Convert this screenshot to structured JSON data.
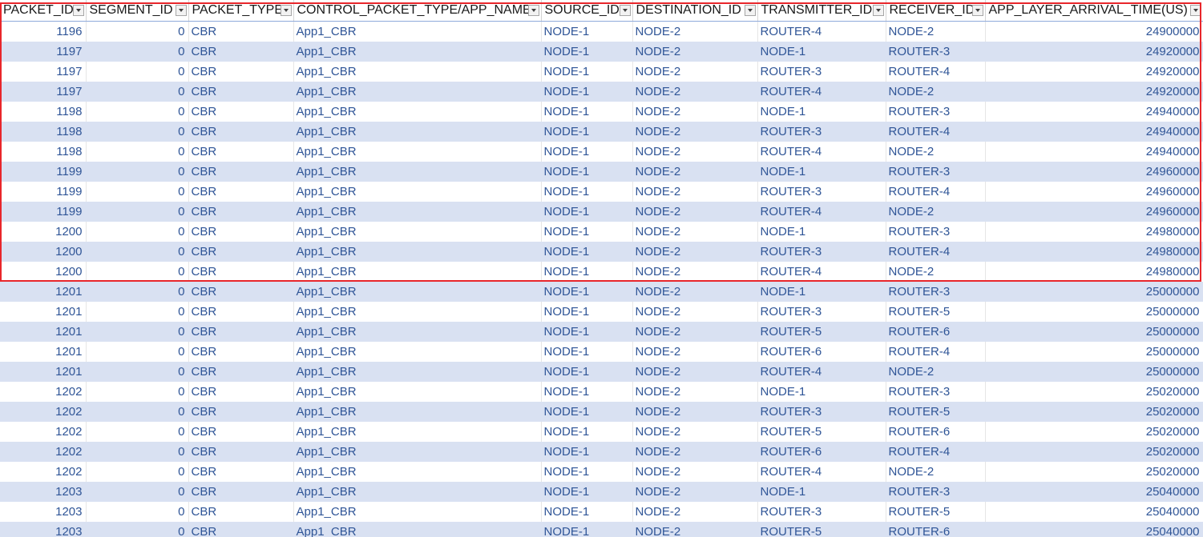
{
  "table": {
    "columns": [
      "PACKET_ID",
      "SEGMENT_ID",
      "PACKET_TYPE",
      "CONTROL_PACKET_TYPE/APP_NAME",
      "SOURCE_ID",
      "DESTINATION_ID",
      "TRANSMITTER_ID",
      "RECEIVER_ID",
      "APP_LAYER_ARRIVAL_TIME(US)"
    ],
    "rows": [
      [
        "1196",
        "0",
        "CBR",
        "App1_CBR",
        "NODE-1",
        "NODE-2",
        "ROUTER-4",
        "NODE-2",
        "24900000"
      ],
      [
        "1197",
        "0",
        "CBR",
        "App1_CBR",
        "NODE-1",
        "NODE-2",
        "NODE-1",
        "ROUTER-3",
        "24920000"
      ],
      [
        "1197",
        "0",
        "CBR",
        "App1_CBR",
        "NODE-1",
        "NODE-2",
        "ROUTER-3",
        "ROUTER-4",
        "24920000"
      ],
      [
        "1197",
        "0",
        "CBR",
        "App1_CBR",
        "NODE-1",
        "NODE-2",
        "ROUTER-4",
        "NODE-2",
        "24920000"
      ],
      [
        "1198",
        "0",
        "CBR",
        "App1_CBR",
        "NODE-1",
        "NODE-2",
        "NODE-1",
        "ROUTER-3",
        "24940000"
      ],
      [
        "1198",
        "0",
        "CBR",
        "App1_CBR",
        "NODE-1",
        "NODE-2",
        "ROUTER-3",
        "ROUTER-4",
        "24940000"
      ],
      [
        "1198",
        "0",
        "CBR",
        "App1_CBR",
        "NODE-1",
        "NODE-2",
        "ROUTER-4",
        "NODE-2",
        "24940000"
      ],
      [
        "1199",
        "0",
        "CBR",
        "App1_CBR",
        "NODE-1",
        "NODE-2",
        "NODE-1",
        "ROUTER-3",
        "24960000"
      ],
      [
        "1199",
        "0",
        "CBR",
        "App1_CBR",
        "NODE-1",
        "NODE-2",
        "ROUTER-3",
        "ROUTER-4",
        "24960000"
      ],
      [
        "1199",
        "0",
        "CBR",
        "App1_CBR",
        "NODE-1",
        "NODE-2",
        "ROUTER-4",
        "NODE-2",
        "24960000"
      ],
      [
        "1200",
        "0",
        "CBR",
        "App1_CBR",
        "NODE-1",
        "NODE-2",
        "NODE-1",
        "ROUTER-3",
        "24980000"
      ],
      [
        "1200",
        "0",
        "CBR",
        "App1_CBR",
        "NODE-1",
        "NODE-2",
        "ROUTER-3",
        "ROUTER-4",
        "24980000"
      ],
      [
        "1200",
        "0",
        "CBR",
        "App1_CBR",
        "NODE-1",
        "NODE-2",
        "ROUTER-4",
        "NODE-2",
        "24980000"
      ],
      [
        "1201",
        "0",
        "CBR",
        "App1_CBR",
        "NODE-1",
        "NODE-2",
        "NODE-1",
        "ROUTER-3",
        "25000000"
      ],
      [
        "1201",
        "0",
        "CBR",
        "App1_CBR",
        "NODE-1",
        "NODE-2",
        "ROUTER-3",
        "ROUTER-5",
        "25000000"
      ],
      [
        "1201",
        "0",
        "CBR",
        "App1_CBR",
        "NODE-1",
        "NODE-2",
        "ROUTER-5",
        "ROUTER-6",
        "25000000"
      ],
      [
        "1201",
        "0",
        "CBR",
        "App1_CBR",
        "NODE-1",
        "NODE-2",
        "ROUTER-6",
        "ROUTER-4",
        "25000000"
      ],
      [
        "1201",
        "0",
        "CBR",
        "App1_CBR",
        "NODE-1",
        "NODE-2",
        "ROUTER-4",
        "NODE-2",
        "25000000"
      ],
      [
        "1202",
        "0",
        "CBR",
        "App1_CBR",
        "NODE-1",
        "NODE-2",
        "NODE-1",
        "ROUTER-3",
        "25020000"
      ],
      [
        "1202",
        "0",
        "CBR",
        "App1_CBR",
        "NODE-1",
        "NODE-2",
        "ROUTER-3",
        "ROUTER-5",
        "25020000"
      ],
      [
        "1202",
        "0",
        "CBR",
        "App1_CBR",
        "NODE-1",
        "NODE-2",
        "ROUTER-5",
        "ROUTER-6",
        "25020000"
      ],
      [
        "1202",
        "0",
        "CBR",
        "App1_CBR",
        "NODE-1",
        "NODE-2",
        "ROUTER-6",
        "ROUTER-4",
        "25020000"
      ],
      [
        "1202",
        "0",
        "CBR",
        "App1_CBR",
        "NODE-1",
        "NODE-2",
        "ROUTER-4",
        "NODE-2",
        "25020000"
      ],
      [
        "1203",
        "0",
        "CBR",
        "App1_CBR",
        "NODE-1",
        "NODE-2",
        "NODE-1",
        "ROUTER-3",
        "25040000"
      ],
      [
        "1203",
        "0",
        "CBR",
        "App1_CBR",
        "NODE-1",
        "NODE-2",
        "ROUTER-3",
        "ROUTER-5",
        "25040000"
      ],
      [
        "1203",
        "0",
        "CBR",
        "App1_CBR",
        "NODE-1",
        "NODE-2",
        "ROUTER-5",
        "ROUTER-6",
        "25040000"
      ]
    ],
    "numeric_columns": [
      0,
      1,
      8
    ],
    "filter_icon": "dropdown-arrow-icon"
  },
  "colors": {
    "band_fill": "#d9e1f2",
    "cell_text": "#2f5597",
    "highlight_border": "#e8262b"
  }
}
